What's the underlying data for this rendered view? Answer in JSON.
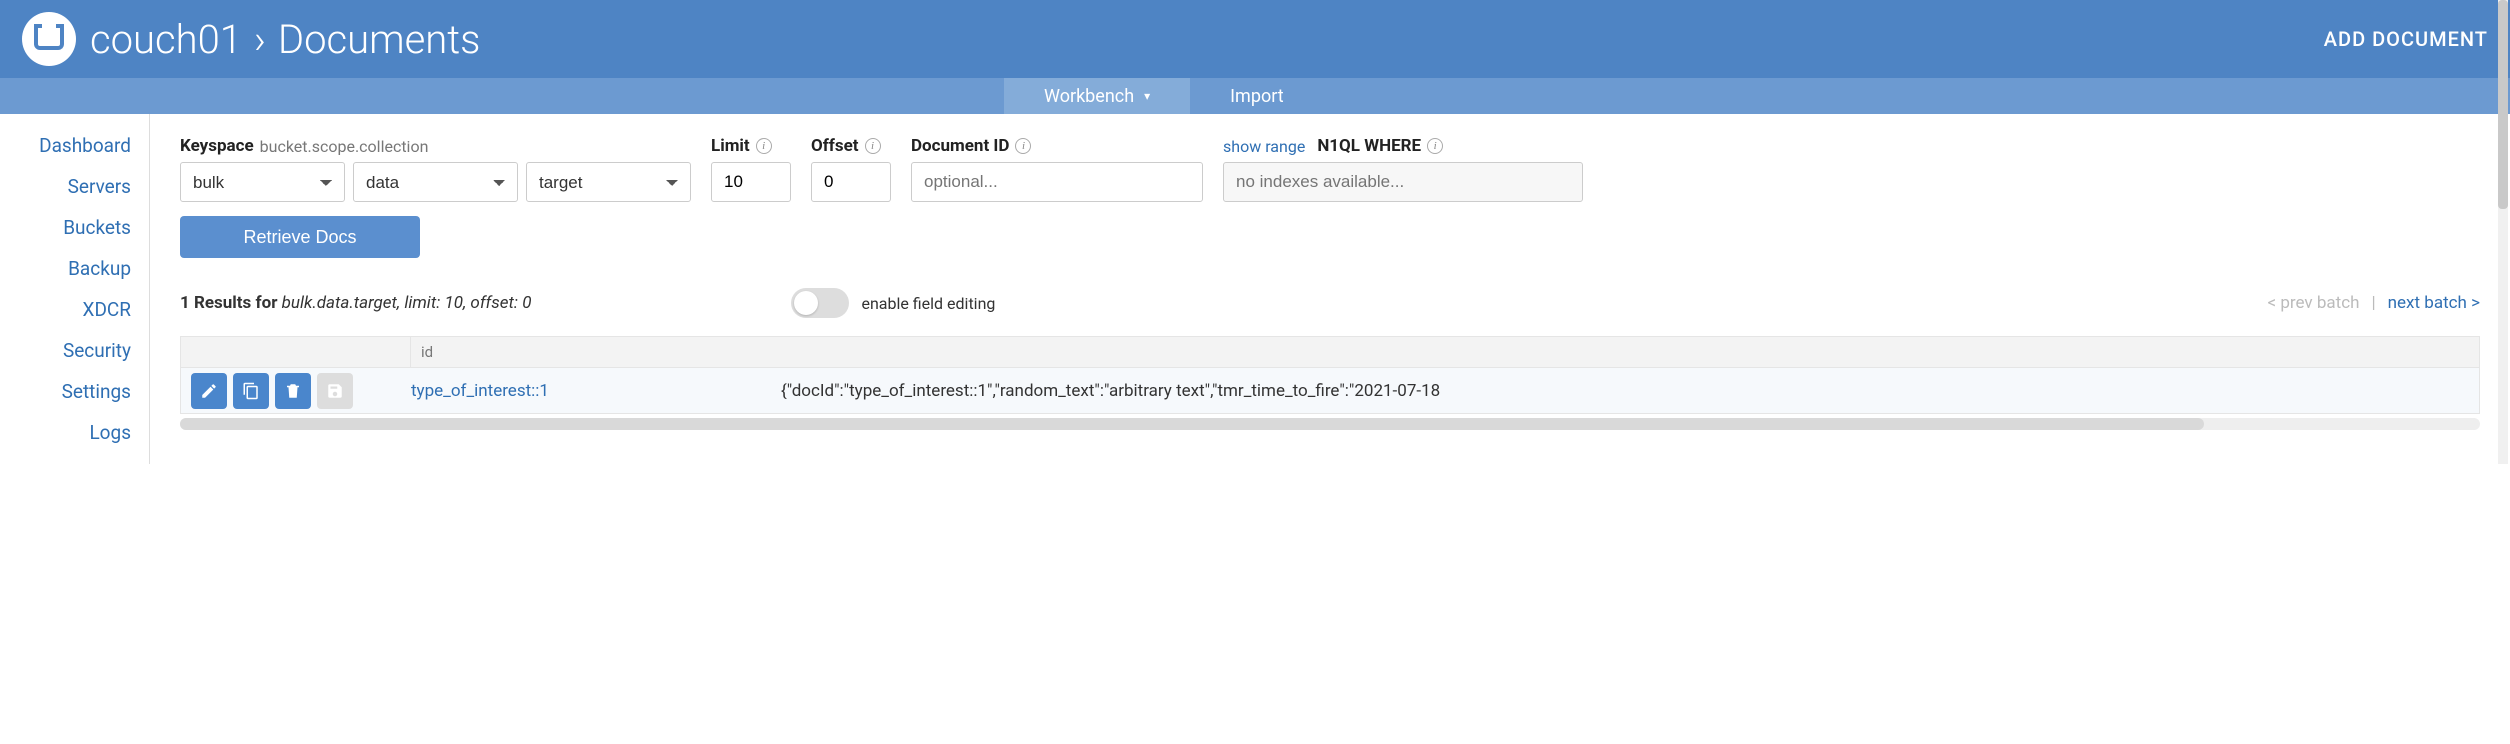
{
  "header": {
    "cluster": "couch01",
    "section": "Documents",
    "add_document": "ADD DOCUMENT"
  },
  "tabs": {
    "workbench": "Workbench",
    "import": "Import"
  },
  "sidebar": {
    "items": [
      "Dashboard",
      "Servers",
      "Buckets",
      "Backup",
      "XDCR",
      "Security",
      "Settings",
      "Logs"
    ]
  },
  "controls": {
    "keyspace_label": "Keyspace",
    "keyspace_hint": "bucket.scope.collection",
    "bucket": "bulk",
    "scope": "data",
    "collection": "target",
    "limit_label": "Limit",
    "limit_value": "10",
    "offset_label": "Offset",
    "offset_value": "0",
    "docid_label": "Document ID",
    "docid_placeholder": "optional...",
    "show_range": "show range",
    "n1ql_label": "N1QL WHERE",
    "n1ql_placeholder": "no indexes available...",
    "retrieve": "Retrieve Docs"
  },
  "results": {
    "count_prefix": "1 Results for ",
    "detail": "bulk.data.target, limit: 10, offset: 0",
    "enable_field_editing": "enable field editing",
    "prev_batch": "< prev batch",
    "next_batch": "next batch >",
    "divider": "|"
  },
  "table": {
    "id_header": "id",
    "rows": [
      {
        "id": "type_of_interest::1",
        "json": "{\"docId\":\"type_of_interest::1\",\"random_text\":\"arbitrary text\",\"tmr_time_to_fire\":\"2021-07-18"
      }
    ]
  }
}
